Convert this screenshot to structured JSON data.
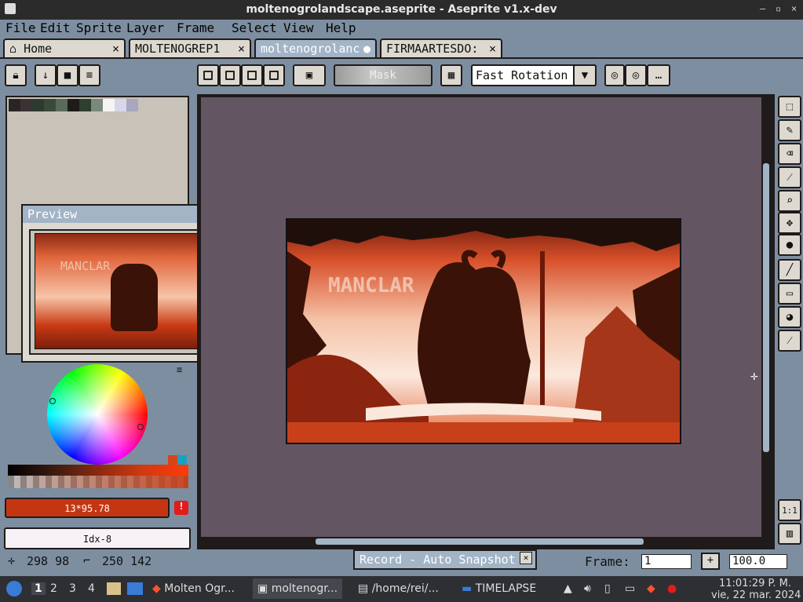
{
  "window": {
    "title": "moltenogrolandscape.aseprite - Aseprite v1.x-dev",
    "controls": [
      "–",
      "▫",
      "×"
    ]
  },
  "menu": [
    "File",
    "Edit",
    "Sprite",
    "Layer",
    "Frame",
    "Select",
    "View",
    "Help"
  ],
  "tabs": [
    {
      "label": "Home",
      "close": "×"
    },
    {
      "label": "MOLTENOGREP1",
      "close": "×"
    },
    {
      "label": "moltenogrolanc",
      "close": "●"
    },
    {
      "label": "FIRMAARTESDO:",
      "close": "×"
    }
  ],
  "toolbar": {
    "mask_label": "Mask",
    "rotation_algorithm": "Fast Rotation"
  },
  "preview": {
    "title": "Preview",
    "art_text": "MANCLAR"
  },
  "color": {
    "foreground_value": "13*95.78",
    "background_value": "Idx-8",
    "foreground_hex": "#c43612"
  },
  "canvas": {
    "art_text": "MANCLAR"
  },
  "status": {
    "cursor_pos": "298 98",
    "selection_size": "250 142",
    "record_label": "Record - Auto Snapshot",
    "frame_label": "Frame:",
    "frame_value": "1",
    "zoom_value": "100.0"
  },
  "taskbar": {
    "workspaces": [
      "1",
      "2",
      "3",
      "4"
    ],
    "tasks": [
      "Molten Ogr...",
      "moltenogr...",
      "/home/rei/...",
      "TIMELAPSE"
    ],
    "clock_time": "11:01:29 P. M.",
    "clock_date": "vie, 22 mar. 2024"
  },
  "palette_colors": [
    "#2a2424",
    "#3b3333",
    "#2c3a30",
    "#3a4a3a",
    "#5a6a5a",
    "#1f1b1b",
    "#2f3f2f",
    "#7a8a7a",
    "#f5f5f5",
    "#d7d7e8",
    "#a7a7c0"
  ]
}
